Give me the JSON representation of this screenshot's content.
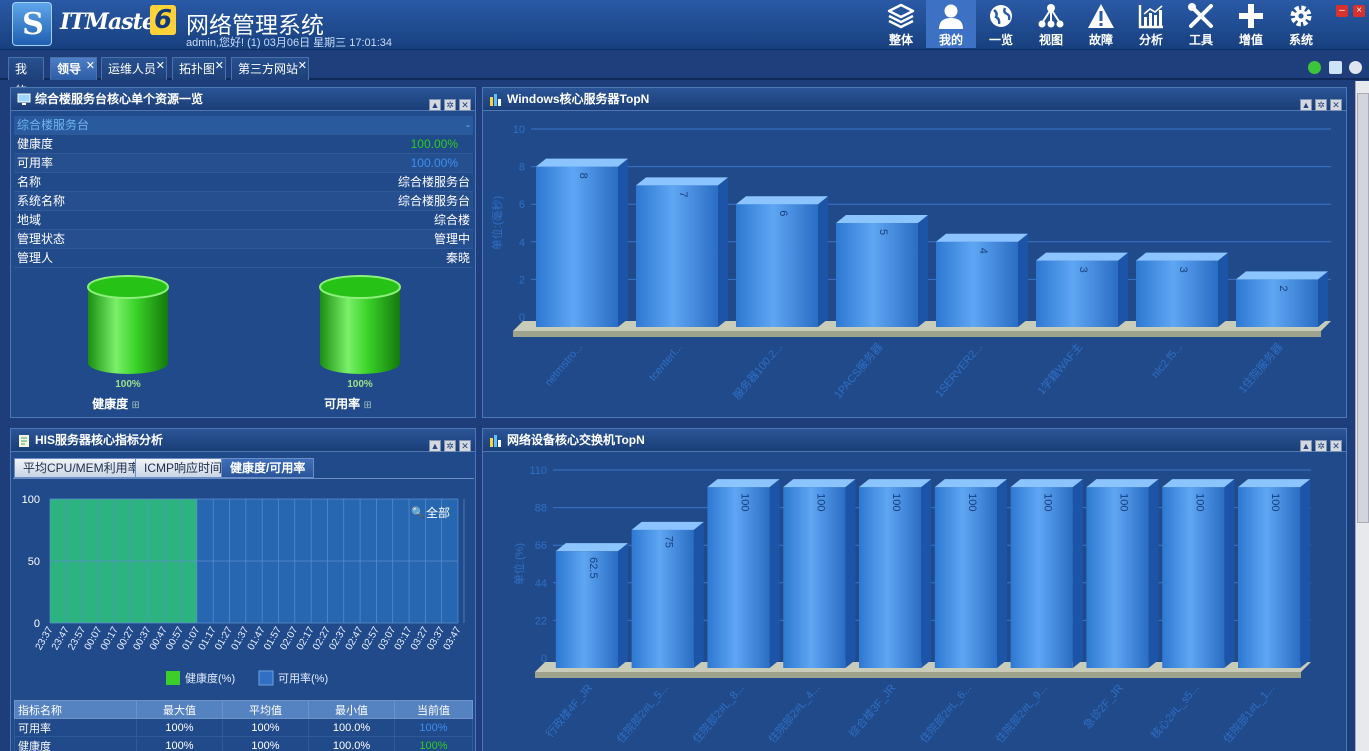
{
  "header": {
    "logo_letter": "S",
    "brand": "ITMaster",
    "brand_version": "6",
    "title": "网络管理系统",
    "user_line": "admin,您好! (1) 03月06日 星期三 17:01:34"
  },
  "nav": [
    {
      "label": "整体",
      "icon": "layers-icon"
    },
    {
      "label": "我的",
      "icon": "user-icon"
    },
    {
      "label": "一览",
      "icon": "globe-icon"
    },
    {
      "label": "视图",
      "icon": "topology-icon"
    },
    {
      "label": "故障",
      "icon": "warning-icon"
    },
    {
      "label": "分析",
      "icon": "chart-icon"
    },
    {
      "label": "工具",
      "icon": "tools-icon"
    },
    {
      "label": "增值",
      "icon": "plus-icon"
    },
    {
      "label": "系统",
      "icon": "gear-icon"
    }
  ],
  "tabs": [
    {
      "label": "我的",
      "closable": false
    },
    {
      "label": "领导",
      "closable": true
    },
    {
      "label": "运维人员",
      "closable": true
    },
    {
      "label": "拓扑图",
      "closable": true
    },
    {
      "label": "第三方网站",
      "closable": true
    }
  ],
  "colors": {
    "accent_green": "#2dcd1a",
    "bar_blue": "#3b8ae0",
    "value_blue": "#3e8ef0"
  },
  "panel1": {
    "title": "综合楼服务台核心单个资源一览",
    "group_label": "综合楼服务台",
    "group_dash": "-",
    "rows": [
      {
        "label": "健康度",
        "value": "100.00%"
      },
      {
        "label": "可用率",
        "value": "100.00%"
      },
      {
        "label": "名称",
        "value": "综合楼服务台"
      },
      {
        "label": "系统名称",
        "value": "综合楼服务台"
      },
      {
        "label": "地域",
        "value": "综合楼"
      },
      {
        "label": "管理状态",
        "value": "管理中"
      },
      {
        "label": "管理人",
        "value": "秦晓"
      }
    ],
    "gauges": [
      {
        "label": "健康度",
        "pct": "100%",
        "level": 1.0
      },
      {
        "label": "可用率",
        "pct": "100%",
        "level": 1.0
      }
    ]
  },
  "panel2": {
    "title": "Windows核心服务器TopN",
    "chart_data": {
      "type": "bar",
      "title": "Windows核心服务器TopN",
      "ylabel": "单位:(毫秒)",
      "ylim": [
        0,
        10
      ],
      "yticks": [
        0,
        2,
        4,
        6,
        8,
        10
      ],
      "categories": [
        "netmstro...",
        "tcenterl...",
        "服务器100.2...",
        "1PACS服务器",
        "1SERVER2...",
        "1学籍WAF主",
        "nlc2.f5...",
        "1住院服务器"
      ],
      "values": [
        8,
        7,
        6,
        5,
        4,
        3,
        3,
        2
      ]
    }
  },
  "panel3": {
    "title": "HIS服务器核心指标分析",
    "subtabs": [
      "平均CPU/MEM利用率",
      "ICMP响应时间",
      "健康度/可用率"
    ],
    "zoom_label": "全部",
    "chart_data": {
      "type": "area",
      "ylim": [
        0,
        100
      ],
      "yticks": [
        0,
        50,
        100
      ],
      "x": [
        "23:37",
        "23:47",
        "23:57",
        "00:07",
        "00:17",
        "00:27",
        "00:37",
        "00:47",
        "00:57",
        "01:07",
        "01:17",
        "01:27",
        "01:37",
        "01:47",
        "01:57",
        "02:07",
        "02:17",
        "02:27",
        "02:37",
        "02:47",
        "02:57",
        "03:07",
        "03:17",
        "03:27",
        "03:37",
        "03:47"
      ],
      "series": [
        {
          "name": "健康度(%)",
          "color": "#2cb380",
          "values": [
            100,
            100,
            100,
            100,
            100,
            100,
            100,
            100,
            100,
            100
          ]
        },
        {
          "name": "可用率(%)",
          "color": "#2766b0",
          "values": [
            100,
            100,
            100,
            100,
            100,
            100,
            100,
            100,
            100,
            100,
            100,
            100,
            100,
            100,
            100,
            100,
            100,
            100,
            100,
            100,
            100,
            100,
            100,
            100,
            100,
            100
          ]
        }
      ]
    },
    "table": {
      "headers": [
        "指标名称",
        "最大值",
        "平均值",
        "最小值",
        "当前值"
      ],
      "rows": [
        [
          "可用率",
          "100%",
          "100%",
          "100.0%",
          "100%"
        ],
        [
          "健康度",
          "100%",
          "100%",
          "100.0%",
          "100%"
        ]
      ]
    }
  },
  "panel4": {
    "title": "网络设备核心交换机TopN",
    "chart_data": {
      "type": "bar",
      "title": "网络设备核心交换机TopN",
      "ylabel": "单位:(%)",
      "ylim": [
        0,
        110
      ],
      "yticks": [
        0,
        22,
        44,
        66,
        88,
        110
      ],
      "categories": [
        "行政楼4F_JR",
        "住院部2#L_5...",
        "住院部2#L_8...",
        "住院部2#L_4...",
        "综合楼3F_JR",
        "住院部2#L_6...",
        "住院部2#L_9...",
        "急诊2F_JR",
        "核心2#L_s5...",
        "住院部1#L_1..."
      ],
      "values": [
        62.5,
        75,
        100,
        100,
        100,
        100,
        100,
        100,
        100,
        100
      ]
    }
  }
}
